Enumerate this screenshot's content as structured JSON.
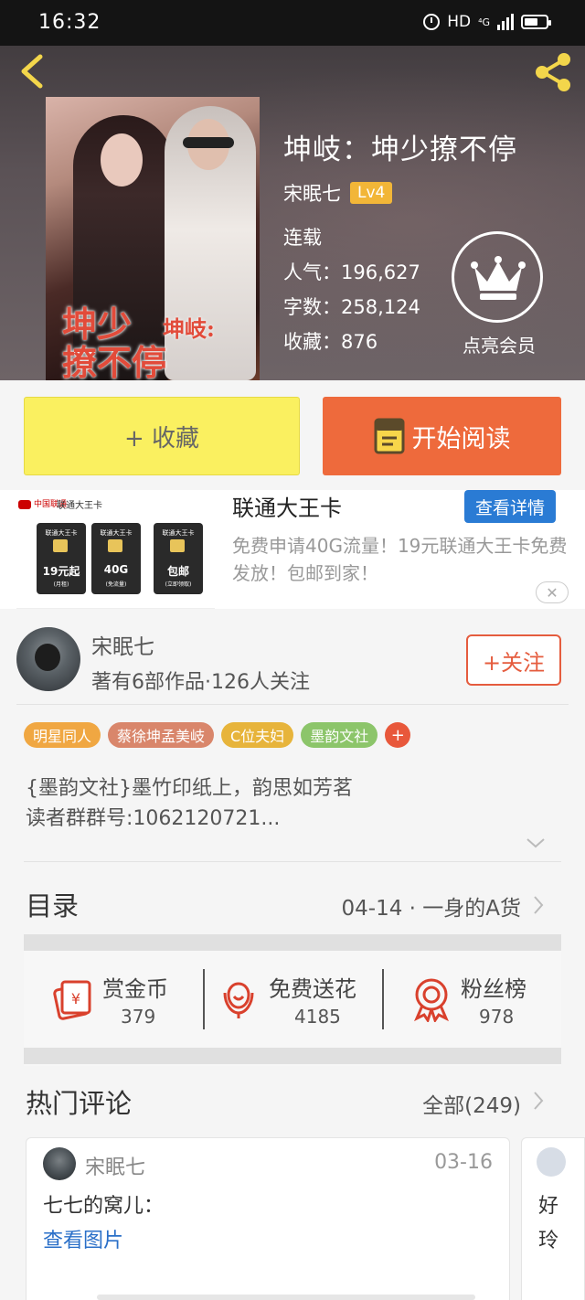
{
  "status_bar": {
    "time": "16:32",
    "network": "HD",
    "signal": "⁴G"
  },
  "book": {
    "title": "坤岐：坤少撩不停",
    "author": "宋眠七",
    "level": "Lv4",
    "status": "连载",
    "popularity": "人气：196,627",
    "word_count": "字数：258,124",
    "favorites": "收藏：876",
    "cover_title_big": "坤少\n撩不停",
    "cover_title_small": "坤岐:"
  },
  "vip": {
    "label": "点亮会员"
  },
  "buttons": {
    "collect": "+ 收藏",
    "read": "开始阅读"
  },
  "ad": {
    "title": "联通大王卡",
    "detail_button": "查看详情",
    "description": "免费申请40G流量！19元联通大王卡免费发放！包邮到家！",
    "close": "✕",
    "logo_text": "中国联通",
    "brand": "联通大王卡",
    "cards": [
      {
        "cap": "联通大王卡",
        "big": "19元起",
        "small": "(月租)"
      },
      {
        "cap": "联通大王卡",
        "big": "40G",
        "small": "(免流量)"
      },
      {
        "cap": "联通大王卡",
        "big": "包邮",
        "small": "(立即领取)"
      }
    ]
  },
  "author_info": {
    "name": "宋眠七",
    "summary": "著有6部作品·126人关注",
    "follow": "+关注"
  },
  "tags": [
    {
      "label": "明星同人",
      "color": "#f0a742"
    },
    {
      "label": "蔡徐坤孟美岐",
      "color": "#d9866b"
    },
    {
      "label": "C位夫妇",
      "color": "#e7b43b"
    },
    {
      "label": "墨韵文社",
      "color": "#8cc56a"
    }
  ],
  "tags_more": "+",
  "intro": {
    "line1": "{墨韵文社}墨竹印纸上，韵思如芳茗",
    "line2": "读者群群号:1062120721..."
  },
  "toc": {
    "label": "目录",
    "latest": "04-14 · 一身的A货"
  },
  "actions": [
    {
      "label": "赏金币",
      "count": "379"
    },
    {
      "label": "免费送花",
      "count": "4185"
    },
    {
      "label": "粉丝榜",
      "count": "978"
    }
  ],
  "comments": {
    "label": "热门评论",
    "all": "全部(249)",
    "items": [
      {
        "user": "宋眠七",
        "date": "03-16",
        "text": "七七的窝儿：",
        "link": "查看图片"
      },
      {
        "line1": "好",
        "line2": "玲"
      }
    ]
  },
  "colors": {
    "accent": "#ee6a3c",
    "collect": "#faf060",
    "link": "#2a6fc8",
    "level": "#f2b638"
  }
}
